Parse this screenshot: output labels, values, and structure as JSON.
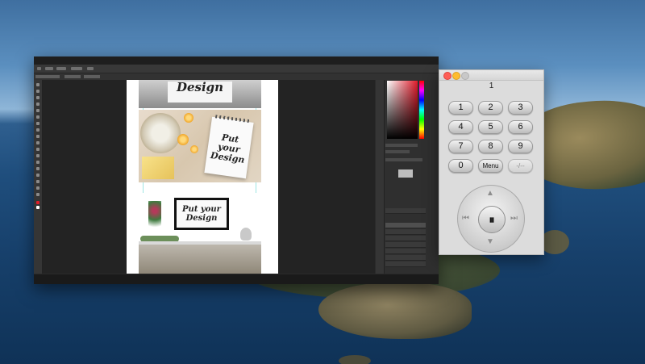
{
  "remote": {
    "display": "1",
    "keys": [
      "1",
      "2",
      "3",
      "4",
      "5",
      "6",
      "7",
      "8",
      "9",
      "0",
      "Menu",
      "-/--"
    ],
    "dpad": {
      "up_icon": "▲",
      "down_icon": "▼",
      "left_icon": "⏮",
      "right_icon": "⏭",
      "center_icon": "⏸"
    }
  },
  "photoshop": {
    "mockup_text": "Design",
    "notebook_text": "Put your Design",
    "monitor_text": "Put your Design"
  },
  "colors": {
    "close": "#fe5f57",
    "minimize": "#febc2e",
    "ps_background": "#2a2a2a"
  }
}
